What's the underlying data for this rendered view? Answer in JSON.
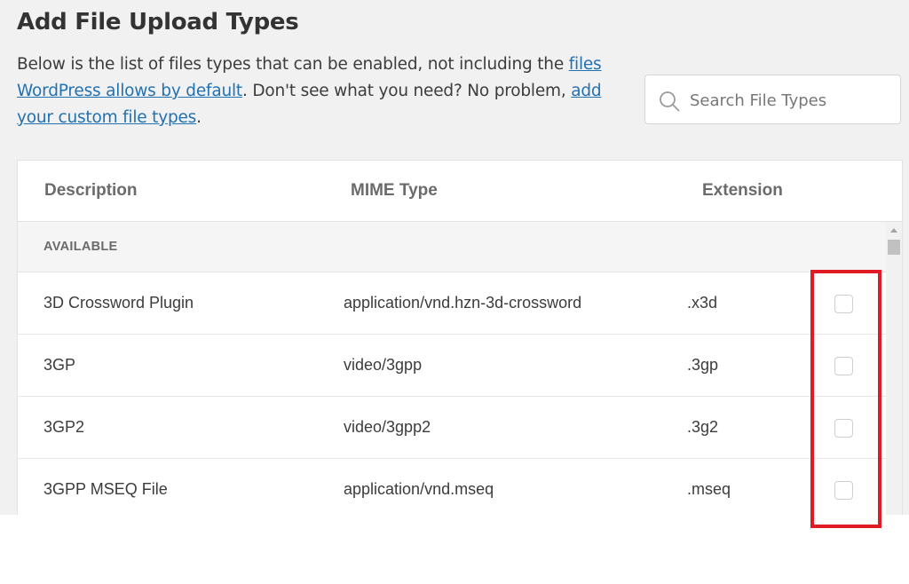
{
  "header": {
    "title": "Add File Upload Types",
    "intro_before": "Below is the list of files types that can be enabled, not including the ",
    "link_default": "files WordPress allows by default",
    "intro_middle": ". Don't see what you need? No problem, ",
    "link_custom": "add your custom file types",
    "intro_after": "."
  },
  "search": {
    "placeholder": "Search File Types",
    "value": ""
  },
  "table": {
    "columns": {
      "description": "Description",
      "mime": "MIME Type",
      "extension": "Extension"
    },
    "group_label": "AVAILABLE",
    "rows": [
      {
        "description": "3D Crossword Plugin",
        "mime": "application/vnd.hzn-3d-crossword",
        "extension": ".x3d",
        "checked": false
      },
      {
        "description": "3GP",
        "mime": "video/3gpp",
        "extension": ".3gp",
        "checked": false
      },
      {
        "description": "3GP2",
        "mime": "video/3gpp2",
        "extension": ".3g2",
        "checked": false
      },
      {
        "description": "3GPP MSEQ File",
        "mime": "application/vnd.mseq",
        "extension": ".mseq",
        "checked": false
      }
    ]
  },
  "colors": {
    "link": "#2271b1",
    "highlight": "#e01b24",
    "background": "#f1f1f1"
  },
  "icons": {
    "search": "search-icon"
  }
}
